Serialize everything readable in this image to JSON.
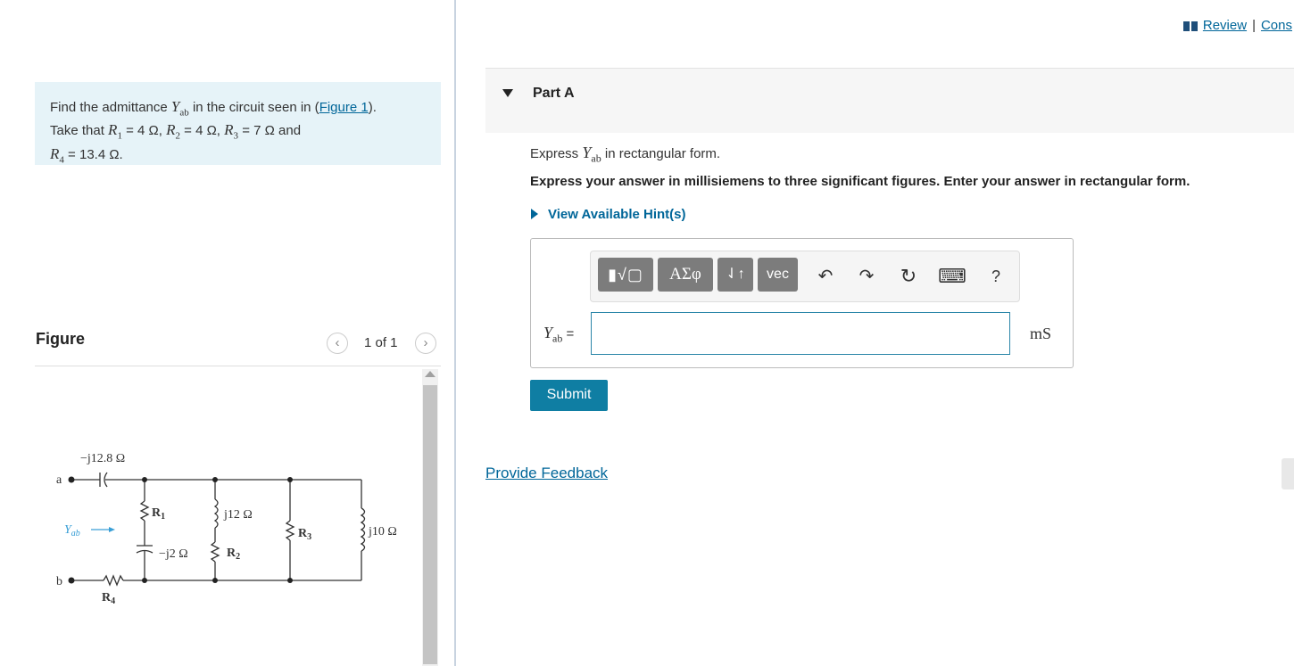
{
  "problem": {
    "line1_prefix": "Find the admittance ",
    "y_symbol": "Y",
    "y_sub": "ab",
    "line1_middle": " in the circuit seen in (",
    "figure_link": "Figure 1",
    "line1_suffix": ").",
    "line2_prefix": "Take that ",
    "r1": "R",
    "r1_sub": "1",
    "r1_val": " = 4 Ω, ",
    "r2": "R",
    "r2_sub": "2",
    "r2_val": " = 4 Ω, ",
    "r3": "R",
    "r3_sub": "3",
    "r3_val": " = 7 Ω and",
    "r4": "R",
    "r4_sub": "4",
    "r4_val": " = 13.4 Ω."
  },
  "figure": {
    "title": "Figure",
    "prev_icon": "‹",
    "next_icon": "›",
    "counter": "1 of 1",
    "labels": {
      "cap_top": "−j12.8 Ω",
      "node_a": "a",
      "node_b": "b",
      "yab": "Y",
      "yab_sub": "ab",
      "r1": "R",
      "r1_sub": "1",
      "cap_mid": "−j2 Ω",
      "ind1": "j12 Ω",
      "r2": "R",
      "r2_sub": "2",
      "r3": "R",
      "r3_sub": "3",
      "ind2": "j10 Ω",
      "r4": "R",
      "r4_sub": "4"
    }
  },
  "header_links": {
    "review": "Review",
    "separator": "|",
    "cons": "Cons"
  },
  "part": {
    "title": "Part A",
    "express_prefix": "Express ",
    "y_symbol": "Y",
    "y_sub": "ab",
    "express_suffix": " in rectangular form.",
    "instructions": "Express your answer in millisiemens to three significant figures. Enter your answer in rectangular form.",
    "hint": "View Available Hint(s)"
  },
  "toolbar": {
    "templates": "▮√▢",
    "greek": "ΑΣφ",
    "arrows": "⇃↑",
    "vec": "vec",
    "undo": "↶",
    "redo": "↷",
    "reset": "↻",
    "keyboard": "⌨",
    "help": "?"
  },
  "answer": {
    "label_symbol": "Y",
    "label_sub": "ab",
    "label_eq": " =",
    "value": "",
    "unit": "mS"
  },
  "submit_label": "Submit",
  "feedback_link": "Provide Feedback",
  "colors": {
    "link": "#006699",
    "submit": "#0f7ea3",
    "problem_bg": "#e6f3f8",
    "toolbar_btn": "#7c7c7c"
  }
}
